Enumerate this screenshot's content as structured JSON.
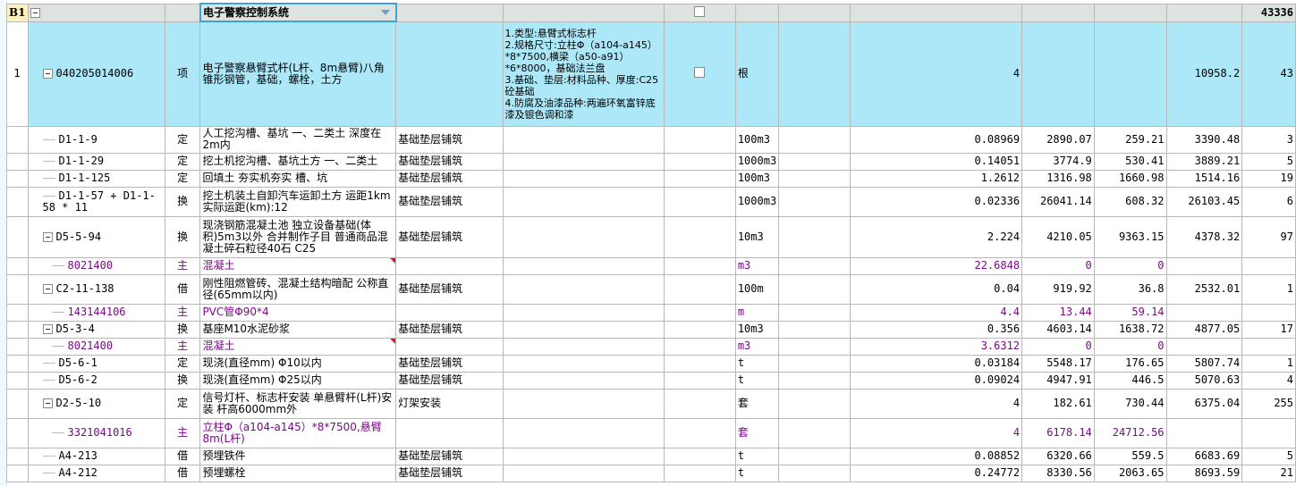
{
  "group": {
    "label": "B1",
    "title": "电子警察控制系统",
    "total": "43336"
  },
  "item": {
    "row_number": "1",
    "code": "040205014006",
    "type": "项",
    "name": "电子警察悬臂式杆(L杆、8m悬臂)八角锥形钢管，基础，螺栓，土方",
    "description": "1.类型:悬臂式标志杆\n2.规格尺寸:立柱Φ（a104-a145）*8*7500,横梁（a50-a91）*6*8000，基础法兰盘\n3.基础、垫层:材料品种、厚度:C25砼基础\n4.防腐及油漆品种:两遍环氧富锌底漆及银色调和漆",
    "unit": "根",
    "quantity": "4",
    "unit_price": "10958.2",
    "total": "43"
  },
  "rows": [
    {
      "code": "D1-1-9",
      "type": "定",
      "name": "人工挖沟槽、基坑 一、二类土 深度在2m内",
      "category": "基础垫层铺筑",
      "unit": "100m3",
      "qty": "0.08969",
      "price": "2890.07",
      "amount": "259.21",
      "comp": "3390.48",
      "last": "3",
      "kind": "sub",
      "h": 30
    },
    {
      "code": "D1-1-29",
      "type": "定",
      "name": "挖土机挖沟槽、基坑土方 一、二类土",
      "category": "基础垫层铺筑",
      "unit": "1000m3",
      "qty": "0.14051",
      "price": "3774.9",
      "amount": "530.41",
      "comp": "3889.21",
      "last": "5",
      "kind": "sub",
      "h": 19
    },
    {
      "code": "D1-1-125",
      "type": "定",
      "name": "回填土 夯实机夯实 槽、坑",
      "category": "基础垫层铺筑",
      "unit": "100m3",
      "qty": "1.2612",
      "price": "1316.98",
      "amount": "1660.98",
      "comp": "1514.16",
      "last": "19",
      "kind": "sub",
      "h": 19
    },
    {
      "code": "D1-1-57 + D1-1-58 * 11",
      "type": "换",
      "name": "挖土机装土自卸汽车运卸土方 运距1km 实际运距(km):12",
      "category": "基础垫层铺筑",
      "unit": "1000m3",
      "qty": "0.02336",
      "price": "26041.14",
      "amount": "608.32",
      "comp": "26103.45",
      "last": "6",
      "kind": "sub",
      "h": 33
    },
    {
      "code": "D5-5-94",
      "type": "换",
      "name": "现浇钢筋混凝土池 独立设备基础(体积)5m3以外  合并制作子目 普通商品混凝土碎石粒径40石 C25",
      "category": "基础垫层铺筑",
      "unit": "10m3",
      "qty": "2.224",
      "price": "4210.05",
      "amount": "9363.15",
      "comp": "4378.32",
      "last": "97",
      "kind": "parent",
      "h": 46
    },
    {
      "code": "8021400",
      "type": "主",
      "name": "混凝土",
      "category": "",
      "unit": "m3",
      "qty": "22.6848",
      "price": "0",
      "amount": "0",
      "comp": "",
      "last": "",
      "kind": "main",
      "h": 19,
      "mark": true
    },
    {
      "code": "C2-11-138",
      "type": "借",
      "name": "刚性阻燃管砖、混凝土结构暗配 公称直径(65mm以内)",
      "category": "基础垫层铺筑",
      "unit": "100m",
      "qty": "0.04",
      "price": "919.92",
      "amount": "36.8",
      "comp": "2532.01",
      "last": "1",
      "kind": "parent",
      "h": 33
    },
    {
      "code": "143144106",
      "type": "主",
      "name": "PVC管Φ90*4",
      "category": "",
      "unit": "m",
      "qty": "4.4",
      "price": "13.44",
      "amount": "59.14",
      "comp": "",
      "last": "",
      "kind": "main",
      "h": 19
    },
    {
      "code": "D5-3-4",
      "type": "换",
      "name": "基座M10水泥砂浆",
      "category": "基础垫层铺筑",
      "unit": "10m3",
      "qty": "0.356",
      "price": "4603.14",
      "amount": "1638.72",
      "comp": "4877.05",
      "last": "17",
      "kind": "parent",
      "h": 19
    },
    {
      "code": "8021400",
      "type": "主",
      "name": "混凝土",
      "category": "",
      "unit": "m3",
      "qty": "3.6312",
      "price": "0",
      "amount": "0",
      "comp": "",
      "last": "",
      "kind": "main",
      "h": 19,
      "mark": true
    },
    {
      "code": "D5-6-1",
      "type": "定",
      "name": "现浇(直径mm) Φ10以内",
      "category": "基础垫层铺筑",
      "unit": "t",
      "qty": "0.03184",
      "price": "5548.17",
      "amount": "176.65",
      "comp": "5807.74",
      "last": "1",
      "kind": "sub",
      "h": 19
    },
    {
      "code": "D5-6-2",
      "type": "换",
      "name": "现浇(直径mm) Φ25以内",
      "category": "基础垫层铺筑",
      "unit": "t",
      "qty": "0.09024",
      "price": "4947.91",
      "amount": "446.5",
      "comp": "5070.63",
      "last": "4",
      "kind": "sub",
      "h": 19
    },
    {
      "code": "D2-5-10",
      "type": "定",
      "name": "信号灯杆、标志杆安装 单悬臂杆(L杆)安装 杆高6000mm外",
      "category": "灯架安装",
      "unit": "套",
      "qty": "4",
      "price": "182.61",
      "amount": "730.44",
      "comp": "6375.04",
      "last": "255",
      "kind": "parent",
      "h": 33
    },
    {
      "code": "3321041016",
      "type": "主",
      "name": "立柱Φ（a104-a145）*8*7500,悬臂8m(L杆)",
      "category": "",
      "unit": "套",
      "qty": "4",
      "price": "6178.14",
      "amount": "24712.56",
      "comp": "",
      "last": "",
      "kind": "main",
      "h": 33
    },
    {
      "code": "A4-213",
      "type": "借",
      "name": "预埋铁件",
      "category": "基础垫层铺筑",
      "unit": "t",
      "qty": "0.08852",
      "price": "6320.66",
      "amount": "559.5",
      "comp": "6683.69",
      "last": "5",
      "kind": "sub",
      "h": 19
    },
    {
      "code": "A4-212",
      "type": "借",
      "name": "预埋螺栓",
      "category": "基础垫层铺筑",
      "unit": "t",
      "qty": "0.24772",
      "price": "8330.56",
      "amount": "2063.65",
      "comp": "8693.59",
      "last": "21",
      "kind": "sub",
      "h": 19
    }
  ]
}
